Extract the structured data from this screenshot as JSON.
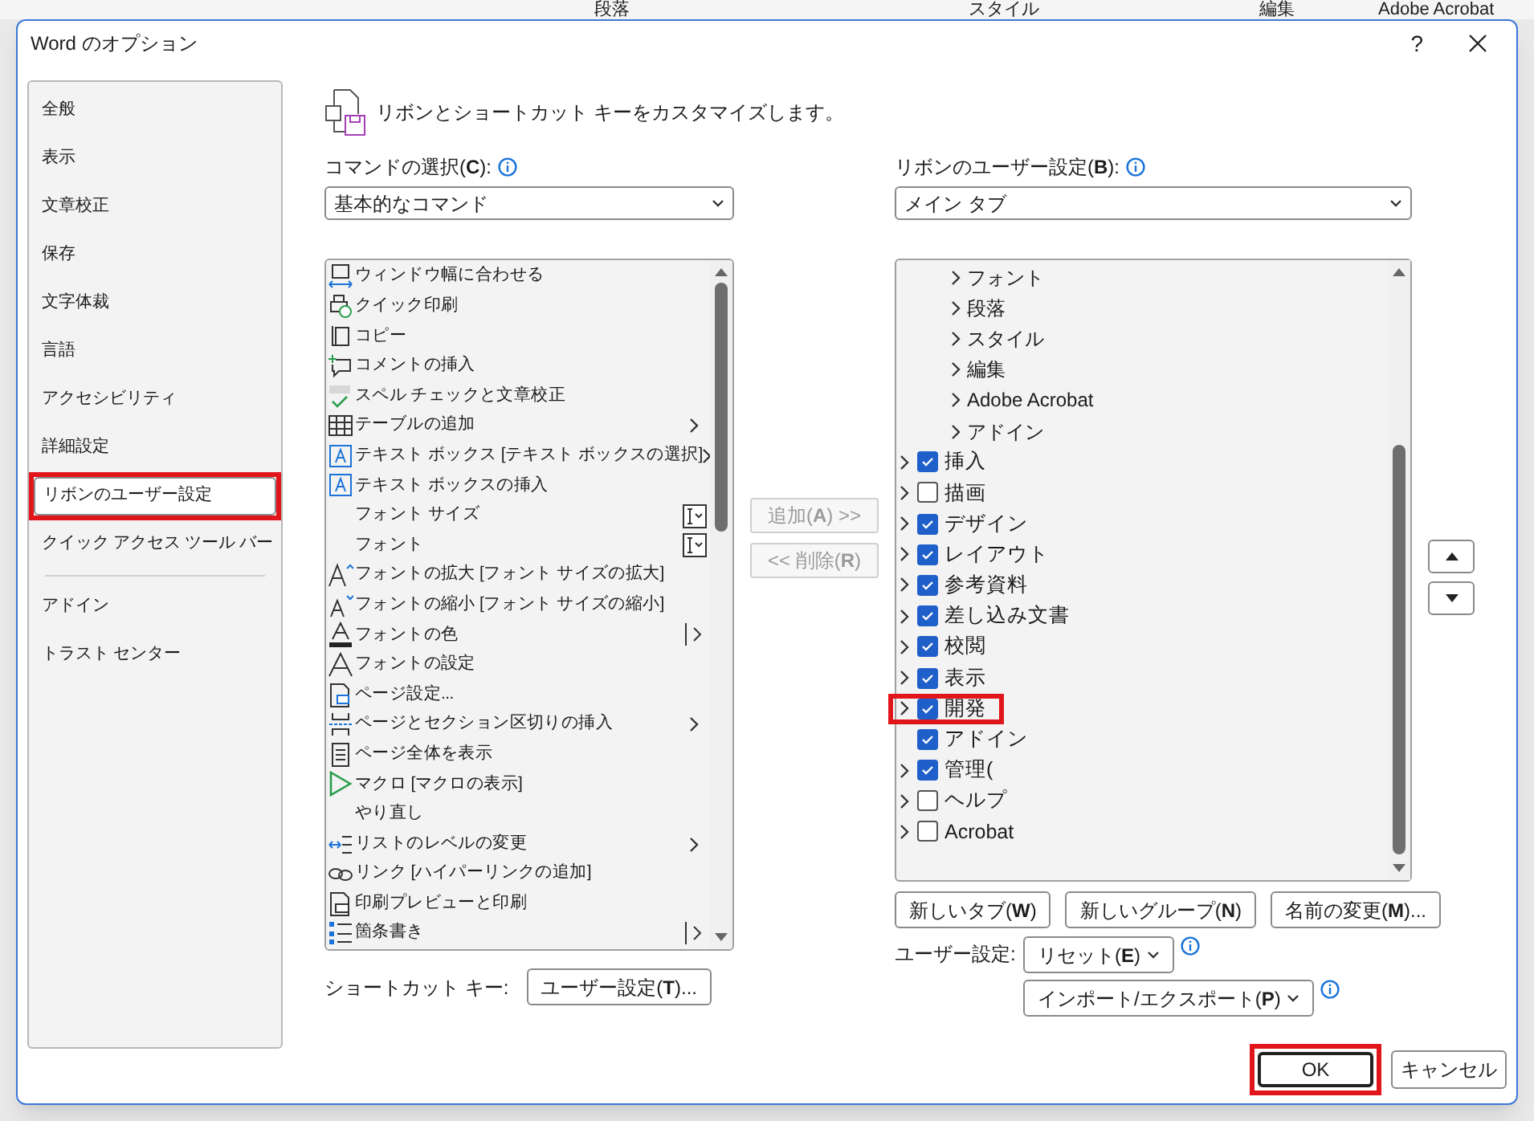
{
  "ribbon_groups": [
    {
      "label": "段落"
    },
    {
      "label": "スタイル"
    },
    {
      "label": "編集"
    },
    {
      "label": "Adobe Acrobat"
    }
  ],
  "window": {
    "title": "Word のオプション",
    "help": "?"
  },
  "sidebar": {
    "items": [
      {
        "label": "全般",
        "selected": false,
        "highlighted": false
      },
      {
        "label": "表示",
        "selected": false,
        "highlighted": false
      },
      {
        "label": "文章校正",
        "selected": false,
        "highlighted": false
      },
      {
        "label": "保存",
        "selected": false,
        "highlighted": false
      },
      {
        "label": "文字体裁",
        "selected": false,
        "highlighted": false
      },
      {
        "label": "言語",
        "selected": false,
        "highlighted": false
      },
      {
        "label": "アクセシビリティ",
        "selected": false,
        "highlighted": false
      },
      {
        "label": "詳細設定",
        "selected": false,
        "highlighted": false
      },
      {
        "label": "リボンのユーザー設定",
        "selected": true,
        "highlighted": true
      },
      {
        "label": "クイック アクセス ツール バー",
        "selected": false,
        "highlighted": false
      },
      {
        "label": "アドイン",
        "selected": false,
        "highlighted": false
      },
      {
        "label": "トラスト センター",
        "selected": false,
        "highlighted": false
      }
    ]
  },
  "heading": "リボンとショートカット キーをカスタマイズします。",
  "commands_label": "コマンドの選択(**C**):",
  "commands_select": {
    "value": "基本的なコマンド"
  },
  "ribbon_label": "リボンのユーザー設定(**B**):",
  "ribbon_select": {
    "value": "メイン タブ"
  },
  "commands": [
    {
      "label": "ウィンドウ幅に合わせる",
      "kind": "plain"
    },
    {
      "label": "クイック印刷",
      "kind": "plain"
    },
    {
      "label": "コピー",
      "kind": "plain"
    },
    {
      "label": "コメントの挿入",
      "kind": "plain"
    },
    {
      "label": "スペル チェックと文章校正",
      "kind": "plain"
    },
    {
      "label": "テーブルの追加",
      "kind": "submenu"
    },
    {
      "label": "テキスト ボックス [テキスト ボックスの選択]",
      "kind": "submenu"
    },
    {
      "label": "テキスト ボックスの挿入",
      "kind": "plain"
    },
    {
      "label": "フォント サイズ",
      "kind": "combo"
    },
    {
      "label": "フォント",
      "kind": "combo"
    },
    {
      "label": "フォントの拡大 [フォント サイズの拡大]",
      "kind": "plain"
    },
    {
      "label": "フォントの縮小 [フォント サイズの縮小]",
      "kind": "plain"
    },
    {
      "label": "フォントの色",
      "kind": "split"
    },
    {
      "label": "フォントの設定",
      "kind": "plain"
    },
    {
      "label": "ページ設定...",
      "kind": "plain"
    },
    {
      "label": "ページとセクション区切りの挿入",
      "kind": "submenu"
    },
    {
      "label": "ページ全体を表示",
      "kind": "plain"
    },
    {
      "label": "マクロ [マクロの表示]",
      "kind": "plain"
    },
    {
      "label": "やり直し",
      "kind": "plain"
    },
    {
      "label": "リストのレベルの変更",
      "kind": "submenu"
    },
    {
      "label": "リンク [ハイパーリンクの追加]",
      "kind": "plain"
    },
    {
      "label": "印刷プレビューと印刷",
      "kind": "plain"
    },
    {
      "label": "箇条書き",
      "kind": "split"
    }
  ],
  "add_button": {
    "label": "追加(**A**) >>",
    "disabled": true
  },
  "remove_button": {
    "label": "<< 削除(**R**)",
    "disabled": true
  },
  "ribbon_tree": [
    {
      "label": "フォント",
      "kind": "group"
    },
    {
      "label": "段落",
      "kind": "group"
    },
    {
      "label": "スタイル",
      "kind": "group"
    },
    {
      "label": "編集",
      "kind": "group"
    },
    {
      "label": "Adobe Acrobat",
      "kind": "group"
    },
    {
      "label": "アドイン",
      "kind": "group"
    },
    {
      "label": "挿入",
      "kind": "tab",
      "checked": true,
      "expandable": true,
      "highlighted": false
    },
    {
      "label": "描画",
      "kind": "tab",
      "checked": false,
      "expandable": true,
      "highlighted": false
    },
    {
      "label": "デザイン",
      "kind": "tab",
      "checked": true,
      "expandable": true,
      "highlighted": false
    },
    {
      "label": "レイアウト",
      "kind": "tab",
      "checked": true,
      "expandable": true,
      "highlighted": false
    },
    {
      "label": "参考資料",
      "kind": "tab",
      "checked": true,
      "expandable": true,
      "highlighted": false
    },
    {
      "label": "差し込み文書",
      "kind": "tab",
      "checked": true,
      "expandable": true,
      "highlighted": false
    },
    {
      "label": "校閲",
      "kind": "tab",
      "checked": true,
      "expandable": true,
      "highlighted": false
    },
    {
      "label": "表示",
      "kind": "tab",
      "checked": true,
      "expandable": true,
      "highlighted": false
    },
    {
      "label": "開発",
      "kind": "tab",
      "checked": true,
      "expandable": true,
      "highlighted": true
    },
    {
      "label": "アドイン",
      "kind": "tab",
      "checked": true,
      "expandable": false,
      "highlighted": false
    },
    {
      "label": "管理(",
      "kind": "tab",
      "checked": true,
      "expandable": true,
      "highlighted": false
    },
    {
      "label": "ヘルプ",
      "kind": "tab",
      "checked": false,
      "expandable": true,
      "highlighted": false
    },
    {
      "label": "Acrobat",
      "kind": "tab",
      "checked": false,
      "expandable": true,
      "highlighted": false
    }
  ],
  "tree_buttons": [
    "新しいタブ(**W**)",
    "新しいグループ(**N**)",
    "名前の変更(**M**)..."
  ],
  "custom_label": "ユーザー設定:",
  "reset_button": "リセット(**E**)",
  "import_export_button": "インポート/エクスポート(**P**)",
  "shortcut_label": "ショートカット キー:",
  "shortcut_button": "ユーザー設定(**T**)...",
  "ok_button": {
    "label": "OK",
    "highlighted": true
  },
  "cancel_button": {
    "label": "キャンセル"
  }
}
